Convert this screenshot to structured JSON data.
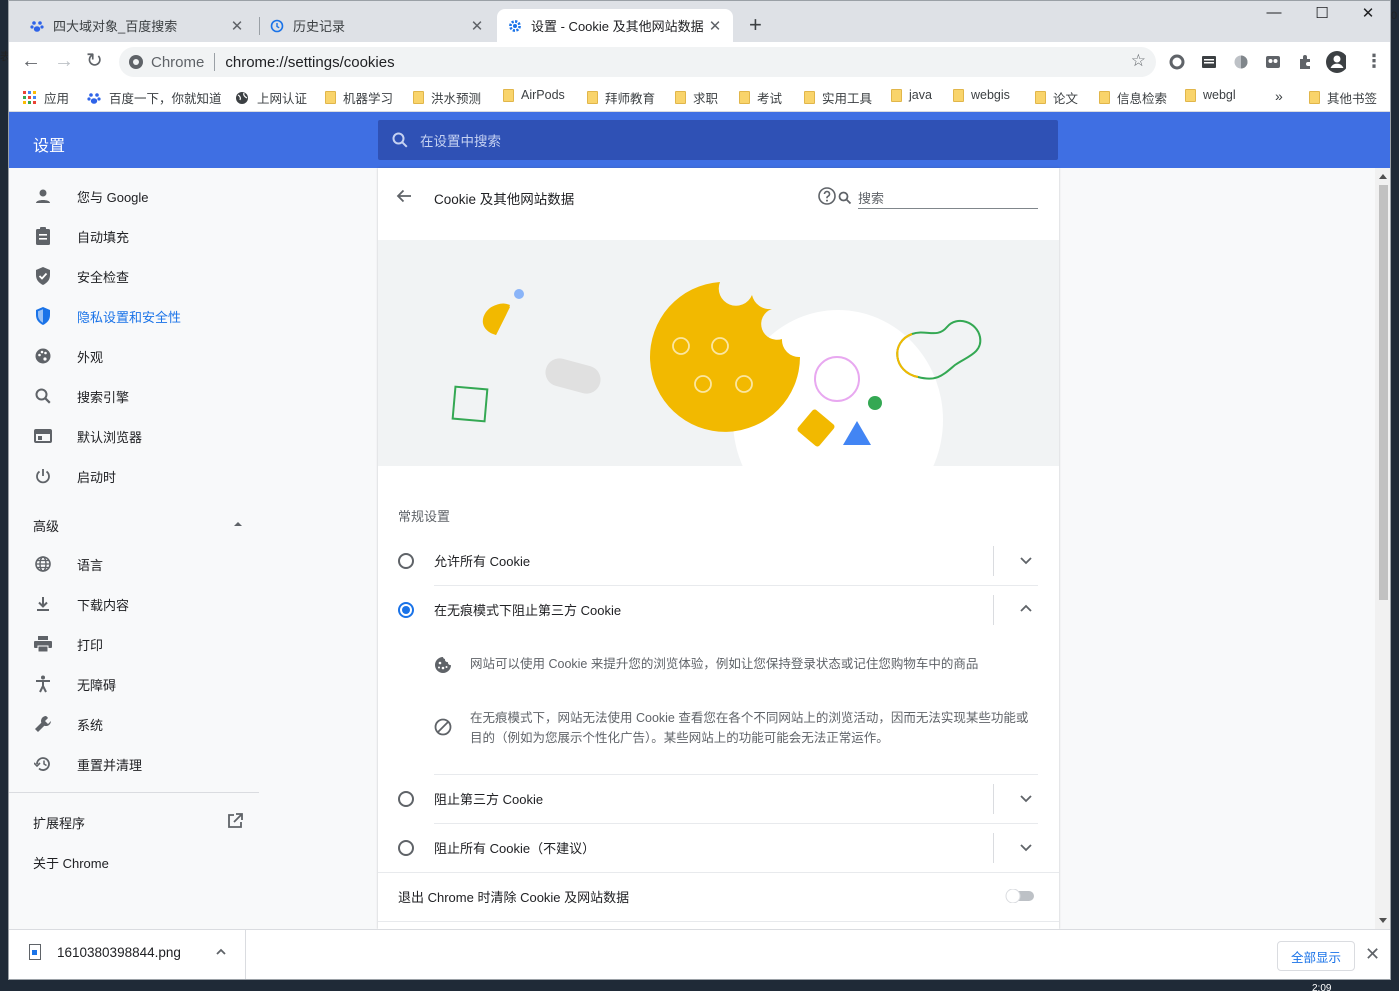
{
  "tabs": [
    {
      "title": "四大域对象_百度搜索",
      "icon": "baidu-paw-icon"
    },
    {
      "title": "历史记录",
      "icon": "history-icon"
    },
    {
      "title": "设置 - Cookie 及其他网站数据",
      "icon": "settings-gear-icon"
    }
  ],
  "window_controls": {
    "minimize": "—",
    "maximize": "☐",
    "close": "✕"
  },
  "omnibox": {
    "chip": "Chrome",
    "url": "chrome://settings/cookies"
  },
  "bookmarks": [
    {
      "label": "应用",
      "icon": "apps-icon"
    },
    {
      "label": "百度一下，你就知道",
      "icon": "baidu-paw-icon"
    },
    {
      "label": "上网认证",
      "icon": "globe-icon"
    },
    {
      "label": "机器学习",
      "icon": "folder-icon"
    },
    {
      "label": "洪水预测",
      "icon": "folder-icon"
    },
    {
      "label": "AirPods",
      "icon": "folder-icon"
    },
    {
      "label": "拜师教育",
      "icon": "folder-icon"
    },
    {
      "label": "求职",
      "icon": "folder-icon"
    },
    {
      "label": "考试",
      "icon": "folder-icon"
    },
    {
      "label": "实用工具",
      "icon": "folder-icon"
    },
    {
      "label": "java",
      "icon": "folder-icon"
    },
    {
      "label": "webgis",
      "icon": "folder-icon"
    },
    {
      "label": "论文",
      "icon": "folder-icon"
    },
    {
      "label": "信息检索",
      "icon": "folder-icon"
    },
    {
      "label": "webgl",
      "icon": "folder-icon"
    }
  ],
  "bookmarks_overflow": "»",
  "other_bookmarks": "其他书签",
  "settings": {
    "title": "设置",
    "search_placeholder": "在设置中搜索"
  },
  "sidebar": {
    "items": [
      {
        "label": "您与 Google",
        "icon": "person-icon"
      },
      {
        "label": "自动填充",
        "icon": "clipboard-icon"
      },
      {
        "label": "安全检查",
        "icon": "shield-check-icon"
      },
      {
        "label": "隐私设置和安全性",
        "icon": "shield-lock-icon",
        "selected": true
      },
      {
        "label": "外观",
        "icon": "palette-icon"
      },
      {
        "label": "搜索引擎",
        "icon": "search-icon"
      },
      {
        "label": "默认浏览器",
        "icon": "browser-window-icon"
      },
      {
        "label": "启动时",
        "icon": "power-icon"
      }
    ],
    "advanced_label": "高级",
    "advanced_items": [
      {
        "label": "语言",
        "icon": "globe-icon"
      },
      {
        "label": "下载内容",
        "icon": "download-icon"
      },
      {
        "label": "打印",
        "icon": "printer-icon"
      },
      {
        "label": "无障碍",
        "icon": "accessibility-icon"
      },
      {
        "label": "系统",
        "icon": "wrench-icon"
      },
      {
        "label": "重置并清理",
        "icon": "restore-icon"
      }
    ],
    "extensions_label": "扩展程序",
    "about_label": "关于 Chrome"
  },
  "cookies_page": {
    "title": "Cookie 及其他网站数据",
    "search_placeholder": "搜索",
    "general_header": "常规设置",
    "options": [
      {
        "label": "允许所有 Cookie",
        "selected": false,
        "expanded": false
      },
      {
        "label": "在无痕模式下阻止第三方 Cookie",
        "selected": true,
        "expanded": true
      },
      {
        "label": "阻止第三方 Cookie",
        "selected": false,
        "expanded": false
      },
      {
        "label": "阻止所有 Cookie（不建议）",
        "selected": false,
        "expanded": false
      }
    ],
    "details": [
      {
        "icon": "cookie-icon",
        "text": "网站可以使用 Cookie 来提升您的浏览体验，例如让您保持登录状态或记住您购物车中的商品"
      },
      {
        "icon": "block-icon",
        "text": "在无痕模式下，网站无法使用 Cookie 查看您在各个不同网站上的浏览活动，因而无法实现某些功能或目的（例如为您展示个性化广告）。某些网站上的功能可能会无法正常运作。"
      }
    ],
    "clear_on_exit": {
      "label": "退出 Chrome 时清除 Cookie 及网站数据",
      "enabled": false
    }
  },
  "download_shelf": {
    "filename": "1610380398844.png",
    "show_all": "全部显示"
  },
  "taskbar_clock": "2:09",
  "colors": {
    "accent_blue": "#1a73e8",
    "settings_bar": "#3f6fe3",
    "search_bg": "#2f51b5",
    "cookie_yellow": "#f2b900"
  }
}
